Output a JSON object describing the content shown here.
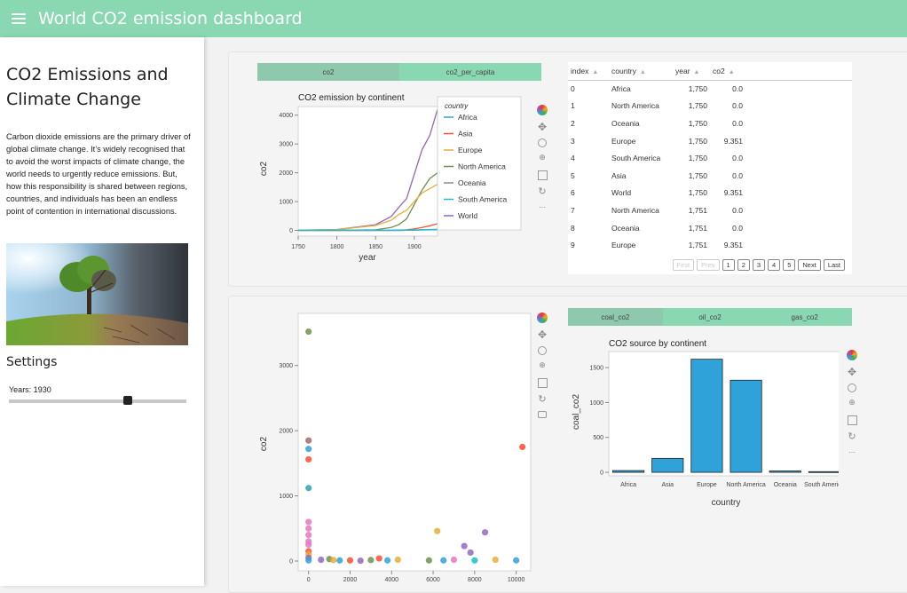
{
  "header": {
    "title": "World CO2 emission dashboard",
    "menu_icon": "hamburger-icon",
    "color": "#8ad8b2"
  },
  "sidebar": {
    "heading": "CO2 Emissions and Climate Change",
    "text": "Carbon dioxide emissions are the primary driver of global climate change. It’s widely recognised that to avoid the worst impacts of climate change, the world needs to urgently reduce emissions. But, how this responsibility is shared between regions, countries, and individuals has been an endless point of contention in international discussions.",
    "settings_title": "Settings",
    "slider": {
      "label": "Years: 1930",
      "value": 1930,
      "fraction": 0.67
    }
  },
  "tabs_top": [
    "co2",
    "co2_per_capita"
  ],
  "tabs_bottom": [
    "coal_co2",
    "oil_co2",
    "gas_co2"
  ],
  "line_chart": {
    "title": "CO2 emission by continent",
    "xlabel": "year",
    "ylabel": "co2",
    "legend_title": "country",
    "legend": [
      {
        "name": "Africa",
        "color": "#30a2da"
      },
      {
        "name": "Asia",
        "color": "#fc4f30"
      },
      {
        "name": "Europe",
        "color": "#e5ae38"
      },
      {
        "name": "North America",
        "color": "#6d904f"
      },
      {
        "name": "Oceania",
        "color": "#8b8b8b"
      },
      {
        "name": "South America",
        "color": "#17becf"
      },
      {
        "name": "World",
        "color": "#9467bd"
      }
    ],
    "x_ticks": [
      "1750",
      "1800",
      "1850",
      "1900"
    ],
    "y_ticks": [
      "0",
      "1000",
      "2000",
      "3000",
      "4000"
    ]
  },
  "table": {
    "columns": [
      "index",
      "country",
      "year",
      "co2"
    ],
    "rows": [
      [
        "0",
        "Africa",
        "1,750",
        "0.0"
      ],
      [
        "1",
        "North America",
        "1,750",
        "0.0"
      ],
      [
        "2",
        "Oceania",
        "1,750",
        "0.0"
      ],
      [
        "3",
        "Europe",
        "1,750",
        "9.351"
      ],
      [
        "4",
        "South America",
        "1,750",
        "0.0"
      ],
      [
        "5",
        "Asia",
        "1,750",
        "0.0"
      ],
      [
        "6",
        "World",
        "1,750",
        "9.351"
      ],
      [
        "7",
        "North America",
        "1,751",
        "0.0"
      ],
      [
        "8",
        "Oceania",
        "1,751",
        "0.0"
      ],
      [
        "9",
        "Europe",
        "1,751",
        "9.351"
      ]
    ],
    "pager": [
      "First",
      "Prev",
      "1",
      "2",
      "3",
      "4",
      "5",
      "Next",
      "Last"
    ]
  },
  "scatter_chart": {
    "ylabel": "co2",
    "x_ticks": [
      "0",
      "2000",
      "4000",
      "6000",
      "8000",
      "10000"
    ],
    "y_ticks": [
      "0",
      "1000",
      "2000",
      "3000"
    ]
  },
  "bar_chart": {
    "title": "CO2 source by continent",
    "xlabel": "country",
    "ylabel": "coal_co2",
    "y_ticks": [
      "0",
      "500",
      "1000",
      "1500"
    ],
    "bar_color": "#30a2da"
  },
  "chart_data": [
    {
      "type": "line",
      "title": "CO2 emission by continent",
      "xlabel": "year",
      "ylabel": "co2",
      "xlim": [
        1750,
        1930
      ],
      "ylim": [
        -200,
        4300
      ],
      "x": [
        1750,
        1800,
        1850,
        1870,
        1880,
        1890,
        1900,
        1910,
        1920,
        1930
      ],
      "series": [
        {
          "name": "World",
          "values": [
            9,
            28,
            197,
            480,
            800,
            1100,
            1950,
            2800,
            3300,
            4200
          ]
        },
        {
          "name": "North America",
          "values": [
            0,
            1,
            20,
            100,
            200,
            400,
            900,
            1400,
            1800,
            2000
          ]
        },
        {
          "name": "Europe",
          "values": [
            9,
            25,
            170,
            350,
            550,
            700,
            1000,
            1300,
            1450,
            1600
          ]
        },
        {
          "name": "Asia",
          "values": [
            0,
            0,
            1,
            5,
            10,
            20,
            50,
            100,
            160,
            230
          ]
        },
        {
          "name": "Africa",
          "values": [
            0,
            0,
            0,
            1,
            2,
            4,
            10,
            20,
            30,
            35
          ]
        },
        {
          "name": "Oceania",
          "values": [
            0,
            0,
            0,
            1,
            3,
            6,
            10,
            15,
            20,
            25
          ]
        },
        {
          "name": "South America",
          "values": [
            0,
            0,
            0,
            1,
            2,
            5,
            10,
            18,
            25,
            30
          ]
        }
      ]
    },
    {
      "type": "scatter",
      "ylabel": "co2",
      "xlim": [
        -500,
        10700
      ],
      "ylim": [
        -150,
        3800
      ],
      "points": [
        {
          "x": 0,
          "y": 3520,
          "color": "#6d904f"
        },
        {
          "x": 0,
          "y": 1850,
          "color": "#9d6a6a"
        },
        {
          "x": 0,
          "y": 1720,
          "color": "#30a2da"
        },
        {
          "x": 0,
          "y": 1560,
          "color": "#fc4f30"
        },
        {
          "x": 0,
          "y": 1120,
          "color": "#2ea3b0"
        },
        {
          "x": 0,
          "y": 600,
          "color": "#e377c2"
        },
        {
          "x": 0,
          "y": 500,
          "color": "#e377c2"
        },
        {
          "x": 0,
          "y": 400,
          "color": "#e377c2"
        },
        {
          "x": 0,
          "y": 300,
          "color": "#e377c2"
        },
        {
          "x": 0,
          "y": 250,
          "color": "#e377c2"
        },
        {
          "x": 0,
          "y": 150,
          "color": "#fc4f30"
        },
        {
          "x": 0,
          "y": 100,
          "color": "#e5ae38"
        },
        {
          "x": 0,
          "y": 50,
          "color": "#9467bd"
        },
        {
          "x": 0,
          "y": 10,
          "color": "#30a2da"
        },
        {
          "x": 10300,
          "y": 1750,
          "color": "#fc4f30"
        },
        {
          "x": 600,
          "y": 20,
          "color": "#9467bd"
        },
        {
          "x": 1000,
          "y": 30,
          "color": "#6d904f"
        },
        {
          "x": 1200,
          "y": 15,
          "color": "#e5ae38"
        },
        {
          "x": 1500,
          "y": 10,
          "color": "#30a2da"
        },
        {
          "x": 2000,
          "y": 10,
          "color": "#fc4f30"
        },
        {
          "x": 2500,
          "y": 5,
          "color": "#9467bd"
        },
        {
          "x": 3000,
          "y": 15,
          "color": "#6d904f"
        },
        {
          "x": 3400,
          "y": 40,
          "color": "#fc4f30"
        },
        {
          "x": 3800,
          "y": 10,
          "color": "#30a2da"
        },
        {
          "x": 4300,
          "y": 20,
          "color": "#e5ae38"
        },
        {
          "x": 5800,
          "y": 10,
          "color": "#6d904f"
        },
        {
          "x": 6200,
          "y": 460,
          "color": "#e5ae38"
        },
        {
          "x": 6500,
          "y": 10,
          "color": "#30a2da"
        },
        {
          "x": 7000,
          "y": 20,
          "color": "#e377c2"
        },
        {
          "x": 7500,
          "y": 230,
          "color": "#9467bd"
        },
        {
          "x": 7800,
          "y": 130,
          "color": "#9467bd"
        },
        {
          "x": 8000,
          "y": 10,
          "color": "#17becf"
        },
        {
          "x": 8500,
          "y": 440,
          "color": "#9467bd"
        },
        {
          "x": 9000,
          "y": 20,
          "color": "#e5ae38"
        },
        {
          "x": 10000,
          "y": 10,
          "color": "#30a2da"
        }
      ]
    },
    {
      "type": "bar",
      "title": "CO2 source by continent",
      "xlabel": "country",
      "ylabel": "coal_co2",
      "categories": [
        "Africa",
        "Asia",
        "Europe",
        "North America",
        "Oceania",
        "South America"
      ],
      "values": [
        25,
        200,
        1620,
        1320,
        20,
        10
      ],
      "ylim": [
        -50,
        1730
      ]
    }
  ]
}
